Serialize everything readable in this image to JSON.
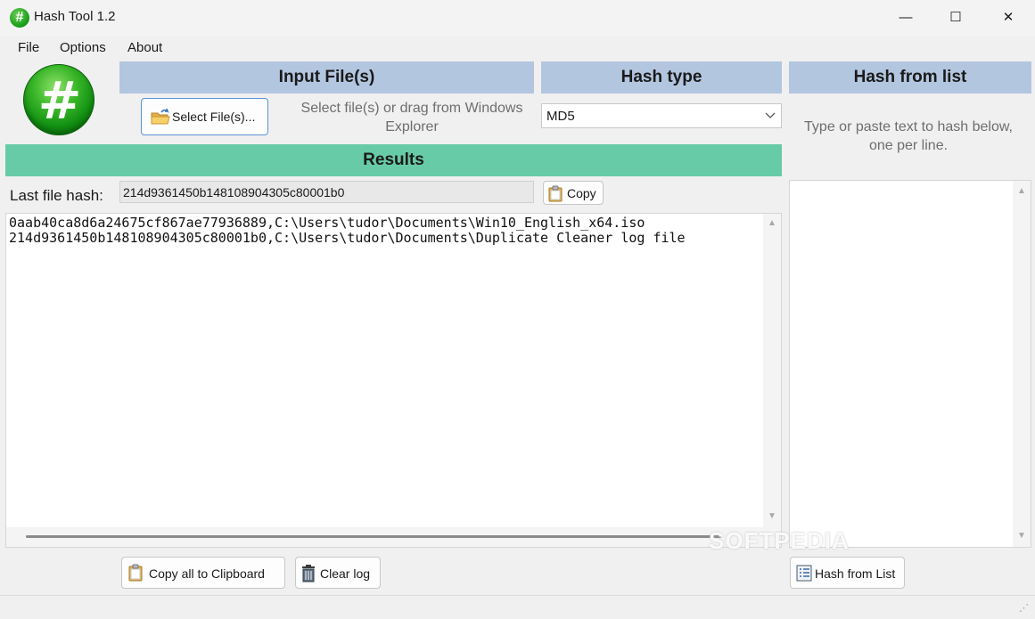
{
  "window": {
    "title": "Hash Tool 1.2",
    "app_icon_glyph": "#",
    "controls": {
      "minimize": "—",
      "maximize": "☐",
      "close": "✕"
    }
  },
  "menu": [
    "File",
    "Options",
    "About"
  ],
  "logo_glyph": "#",
  "input": {
    "header": "Input File(s)",
    "select_button": "Select File(s)...",
    "hint": "Select file(s) or drag from Windows Explorer"
  },
  "hash_type": {
    "header": "Hash type",
    "selected": "MD5"
  },
  "hash_from_list": {
    "header": "Hash from list",
    "hint": "Type or paste text to hash below, one per line.",
    "button": "Hash from List"
  },
  "results": {
    "header": "Results",
    "last_hash_label": "Last file hash:",
    "last_hash_value": "214d9361450b148108904305c80001b0",
    "copy_button": "Copy",
    "log_lines": [
      "0aab40ca8d6a24675cf867ae77936889,C:\\Users\\tudor\\Documents\\Win10_English_x64.iso",
      "214d9361450b148108904305c80001b0,C:\\Users\\tudor\\Documents\\Duplicate Cleaner log file"
    ],
    "copy_all_button": "Copy all to Clipboard",
    "clear_button": "Clear log"
  },
  "watermark": "SOFTPEDIA",
  "colors": {
    "section_header": "#b3c6e0",
    "results_header": "#67cba7",
    "logo_green": "#159a17"
  },
  "icons": {
    "app": "hash-logo-icon",
    "folder": "folder-open-icon",
    "clipboard": "clipboard-icon",
    "trash": "trash-icon",
    "list": "list-icon",
    "dropdown": "chevron-down-icon"
  }
}
